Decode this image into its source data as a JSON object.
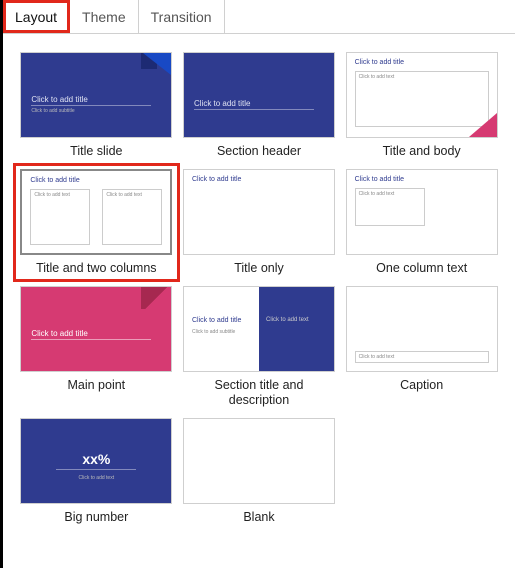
{
  "tabs": {
    "layout": "Layout",
    "theme": "Theme",
    "transition": "Transition"
  },
  "ph": {
    "title": "Click to add title",
    "subtitle": "Click to add subtitle",
    "text": "Click to add text"
  },
  "bignum": "xx%",
  "layouts": {
    "title_slide": "Title slide",
    "section_header": "Section header",
    "title_body": "Title and body",
    "title_two_cols": "Title and two columns",
    "title_only": "Title only",
    "one_col_text": "One column text",
    "main_point": "Main point",
    "section_title_desc": "Section title and description",
    "caption": "Caption",
    "big_number": "Big number",
    "blank": "Blank"
  }
}
